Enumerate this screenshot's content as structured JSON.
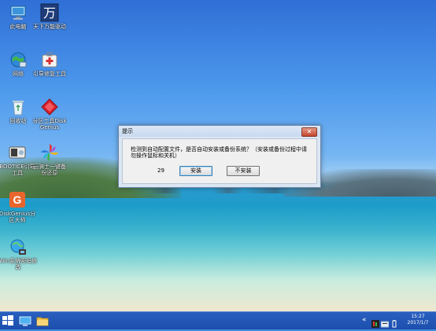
{
  "desktop_icons": [
    {
      "label": "此电脑"
    },
    {
      "label": "天下万能驱动"
    },
    {
      "label": "网络"
    },
    {
      "label": "引导修复工具"
    },
    {
      "label": "回收站"
    },
    {
      "label": "分区工具DiskGenius"
    },
    {
      "label": "BOOTICE引导工具"
    },
    {
      "label": "云骑士一键备份还原"
    },
    {
      "label": "DiskGenius分区大师"
    },
    {
      "label": "Win系统密码修改"
    }
  ],
  "dialog": {
    "title": "提示",
    "close_label": "✕",
    "message": "检测到自动配置文件，是否自动安装或备份系统？（安装或备份过程中请勿操作鼠标和关机）",
    "countdown": "29",
    "install_label": "安装",
    "cancel_label": "不安装"
  },
  "taskbar": {
    "tray_arrow": "«",
    "clock_time": "15:27",
    "clock_date": "2017/1/7"
  },
  "colors": {
    "taskbar": "#1c4fae",
    "dialog_close": "#c4432d",
    "dialog_frame": "#dbe6f3"
  }
}
